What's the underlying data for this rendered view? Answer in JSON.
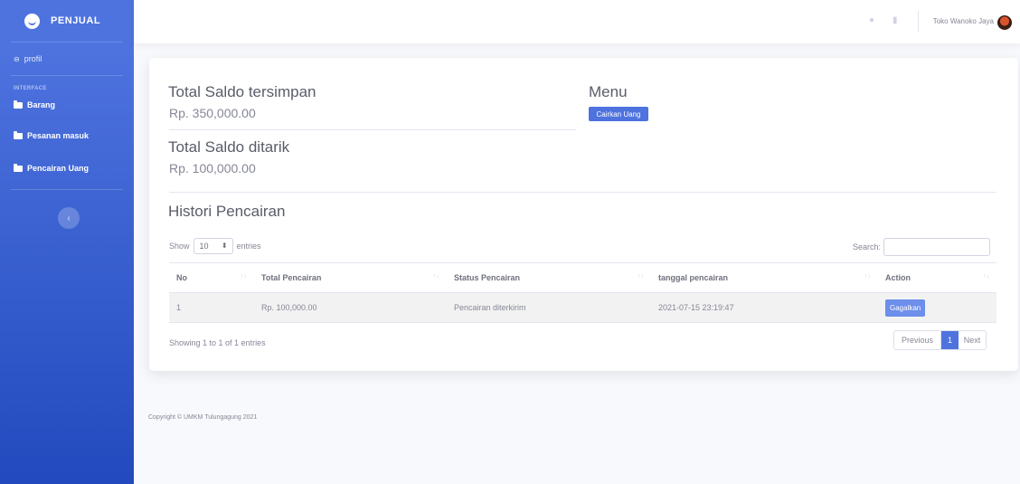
{
  "sidebar": {
    "brand": "PENJUAL",
    "profile_label": "profil",
    "section_heading": "INTERFACE",
    "items": [
      {
        "label": "Barang"
      },
      {
        "label": "Pesanan masuk"
      },
      {
        "label": "Pencairan Uang"
      }
    ],
    "toggle_icon": "‹"
  },
  "topbar": {
    "user_name": "Toko Wanoko Jaya",
    "icons": [
      "chat-icon",
      "document-icon"
    ]
  },
  "summary": {
    "saved_title": "Total Saldo tersimpan",
    "saved_value": "Rp. 350,000.00",
    "withdrawn_title": "Total Saldo ditarik",
    "withdrawn_value": "Rp. 100,000.00",
    "menu_title": "Menu",
    "cashout_button": "Cairkan Uang"
  },
  "history": {
    "title": "Histori Pencairan",
    "show_label": "Show",
    "entries_value": "10",
    "entries_label": "entries",
    "search_label": "Search:",
    "search_value": "",
    "columns": [
      "No",
      "Total Pencairan",
      "Status Pencairan",
      "tanggal pencairan",
      "Action"
    ],
    "rows": [
      {
        "no": "1",
        "total": "Rp. 100,000.00",
        "status": "Pencairan diterkirim",
        "date": "2021-07-15 23:19:47",
        "action": "Gagalkan"
      }
    ],
    "info": "Showing 1 to 1 of 1 entries",
    "pagination": {
      "previous": "Previous",
      "current": "1",
      "next": "Next"
    }
  },
  "footer": {
    "copyright": "Copyright © UMKM Tulungagung 2021"
  },
  "colors": {
    "primary": "#4e73df",
    "sidebar_gradient_end": "#224abe",
    "background": "#f8f9fc"
  }
}
